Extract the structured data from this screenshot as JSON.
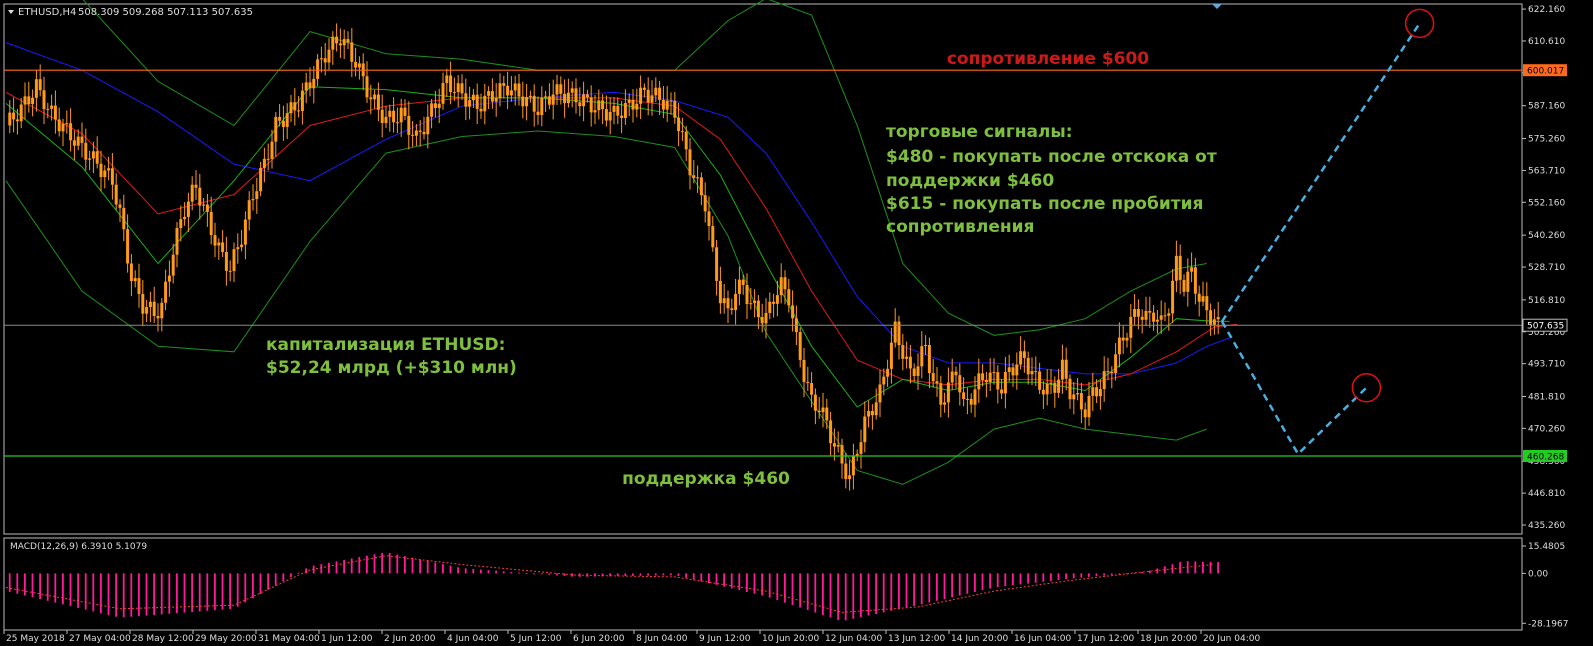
{
  "header": {
    "symbol": "ETHUSD,H4",
    "ohlc": "508.309 509.268 507.113 507.635"
  },
  "annotations": {
    "resistance": "сопротивление $600",
    "support": "поддержка $460",
    "signals_title": "торговые сигналы:",
    "signal_1a": "$480 - покупать после отскока от",
    "signal_1b": "поддержки $460",
    "signal_2a": "$615 - покупать после пробития",
    "signal_2b": "сопротивления",
    "cap_title": "капитализация ETHUSD:",
    "cap_value": "$52,24 млрд (+$310 млн)"
  },
  "macd": {
    "label": "MACD(12,26,9) 6.3910 5.1079",
    "ticks": [
      "15.4805",
      "0.00",
      "-28.1967"
    ]
  },
  "colors": {
    "resistance": "#ff6a1a",
    "support": "#22cc22",
    "current_price": "#8c8c8c",
    "candle": "#ff9a1a",
    "ma_blue": "#1a1aff",
    "ma_red": "#e01a1a",
    "ma_green": "#19b019",
    "bollinger": "#1d8f1d",
    "macd_hist": "#ff1a9c",
    "forecast": "#4aaee0",
    "text_red": "#cc1a1a",
    "text_green": "#7fbf3f"
  },
  "chart_data": {
    "type": "candlestick",
    "symbol": "ETHUSD",
    "timeframe": "H4",
    "y_ticks": [
      "622.160",
      "610.610",
      "599.060",
      "587.160",
      "575.260",
      "563.710",
      "552.160",
      "540.260",
      "528.710",
      "516.810",
      "505.260",
      "493.710",
      "481.810",
      "470.260",
      "458.360",
      "446.810",
      "435.260"
    ],
    "ylim": [
      432,
      624
    ],
    "x_ticks": [
      "25 May 2018",
      "27 May 04:00",
      "28 May 12:00",
      "29 May 20:00",
      "31 May 04:00",
      "1 Jun 12:00",
      "2 Jun 20:00",
      "4 Jun 04:00",
      "5 Jun 12:00",
      "6 Jun 20:00",
      "8 Jun 04:00",
      "9 Jun 12:00",
      "10 Jun 20:00",
      "12 Jun 04:00",
      "13 Jun 12:00",
      "14 Jun 20:00",
      "16 Jun 04:00",
      "17 Jun 12:00",
      "18 Jun 20:00",
      "20 Jun 04:00"
    ],
    "levels": {
      "resistance": 600.017,
      "support": 460.268,
      "current": 507.635
    },
    "price_tags": [
      "600.017",
      "507.635",
      "460.268"
    ],
    "close_path": [
      [
        0,
        580
      ],
      [
        4,
        586
      ],
      [
        8,
        594
      ],
      [
        12,
        584
      ],
      [
        16,
        578
      ],
      [
        20,
        572
      ],
      [
        24,
        566
      ],
      [
        28,
        560
      ],
      [
        30,
        548
      ],
      [
        33,
        525
      ],
      [
        36,
        515
      ],
      [
        39,
        512
      ],
      [
        41,
        514
      ],
      [
        44,
        535
      ],
      [
        47,
        550
      ],
      [
        50,
        558
      ],
      [
        53,
        546
      ],
      [
        56,
        535
      ],
      [
        59,
        528
      ],
      [
        62,
        540
      ],
      [
        65,
        555
      ],
      [
        68,
        566
      ],
      [
        71,
        580
      ],
      [
        74,
        584
      ],
      [
        77,
        588
      ],
      [
        80,
        596
      ],
      [
        84,
        606
      ],
      [
        88,
        612
      ],
      [
        92,
        603
      ],
      [
        96,
        590
      ],
      [
        100,
        582
      ],
      [
        104,
        584
      ],
      [
        108,
        575
      ],
      [
        112,
        585
      ],
      [
        116,
        596
      ],
      [
        120,
        591
      ],
      [
        124,
        587
      ],
      [
        128,
        591
      ],
      [
        132,
        594
      ],
      [
        136,
        590
      ],
      [
        140,
        586
      ],
      [
        144,
        592
      ],
      [
        148,
        591
      ],
      [
        152,
        589
      ],
      [
        156,
        586
      ],
      [
        160,
        584
      ],
      [
        164,
        587
      ],
      [
        168,
        592
      ],
      [
        172,
        590
      ],
      [
        176,
        585
      ],
      [
        178,
        575
      ],
      [
        180,
        565
      ],
      [
        182,
        558
      ],
      [
        184,
        552
      ],
      [
        186,
        533
      ],
      [
        188,
        518
      ],
      [
        190,
        512
      ],
      [
        192,
        520
      ],
      [
        194,
        522
      ],
      [
        196,
        515
      ],
      [
        198,
        512
      ],
      [
        200,
        510
      ],
      [
        202,
        518
      ],
      [
        204,
        522
      ],
      [
        206,
        518
      ],
      [
        208,
        502
      ],
      [
        210,
        490
      ],
      [
        212,
        480
      ],
      [
        214,
        478
      ],
      [
        216,
        472
      ],
      [
        218,
        464
      ],
      [
        220,
        458
      ],
      [
        222,
        452
      ],
      [
        224,
        463
      ],
      [
        226,
        472
      ],
      [
        228,
        478
      ],
      [
        230,
        483
      ],
      [
        232,
        495
      ],
      [
        234,
        506
      ],
      [
        236,
        498
      ],
      [
        238,
        490
      ],
      [
        240,
        494
      ],
      [
        242,
        500
      ],
      [
        244,
        487
      ],
      [
        246,
        480
      ],
      [
        248,
        485
      ],
      [
        250,
        492
      ],
      [
        252,
        478
      ],
      [
        254,
        482
      ],
      [
        256,
        487
      ],
      [
        258,
        490
      ],
      [
        260,
        488
      ],
      [
        262,
        485
      ],
      [
        264,
        491
      ],
      [
        266,
        494
      ],
      [
        268,
        496
      ],
      [
        270,
        490
      ],
      [
        272,
        486
      ],
      [
        274,
        484
      ],
      [
        276,
        486
      ],
      [
        278,
        492
      ],
      [
        280,
        484
      ],
      [
        282,
        480
      ],
      [
        284,
        477
      ],
      [
        286,
        483
      ],
      [
        288,
        486
      ],
      [
        290,
        490
      ],
      [
        292,
        497
      ],
      [
        294,
        503
      ],
      [
        296,
        509
      ],
      [
        298,
        513
      ],
      [
        300,
        510
      ],
      [
        302,
        512
      ],
      [
        304,
        508
      ],
      [
        306,
        515
      ],
      [
        308,
        530
      ],
      [
        310,
        522
      ],
      [
        312,
        527
      ],
      [
        314,
        517
      ],
      [
        316,
        513
      ],
      [
        318,
        509
      ],
      [
        319,
        507.6
      ]
    ],
    "series": [
      {
        "name": "MA blue",
        "values": [
          [
            0,
            610
          ],
          [
            20,
            600
          ],
          [
            40,
            585
          ],
          [
            60,
            566
          ],
          [
            80,
            560
          ],
          [
            100,
            575
          ],
          [
            120,
            587
          ],
          [
            140,
            590
          ],
          [
            160,
            592
          ],
          [
            176,
            589
          ],
          [
            190,
            583
          ],
          [
            200,
            570
          ],
          [
            212,
            545
          ],
          [
            224,
            518
          ],
          [
            236,
            500
          ],
          [
            248,
            494
          ],
          [
            260,
            494
          ],
          [
            272,
            492
          ],
          [
            284,
            490
          ],
          [
            296,
            490
          ],
          [
            308,
            494
          ],
          [
            316,
            500
          ],
          [
            322,
            503
          ]
        ]
      },
      {
        "name": "MA red",
        "values": [
          [
            0,
            592
          ],
          [
            20,
            577
          ],
          [
            40,
            548
          ],
          [
            60,
            555
          ],
          [
            80,
            580
          ],
          [
            100,
            587
          ],
          [
            120,
            590
          ],
          [
            140,
            590
          ],
          [
            160,
            590
          ],
          [
            176,
            587
          ],
          [
            188,
            575
          ],
          [
            200,
            550
          ],
          [
            212,
            520
          ],
          [
            224,
            495
          ],
          [
            236,
            488
          ],
          [
            248,
            486
          ],
          [
            260,
            488
          ],
          [
            272,
            488
          ],
          [
            284,
            486
          ],
          [
            296,
            490
          ],
          [
            308,
            498
          ],
          [
            318,
            507
          ],
          [
            324,
            508
          ]
        ]
      },
      {
        "name": "MA green",
        "values": [
          [
            0,
            588
          ],
          [
            20,
            565
          ],
          [
            40,
            530
          ],
          [
            60,
            560
          ],
          [
            80,
            594
          ],
          [
            100,
            593
          ],
          [
            120,
            590
          ],
          [
            140,
            590
          ],
          [
            160,
            588
          ],
          [
            176,
            584
          ],
          [
            188,
            562
          ],
          [
            200,
            530
          ],
          [
            212,
            500
          ],
          [
            224,
            478
          ],
          [
            236,
            488
          ],
          [
            248,
            484
          ],
          [
            260,
            487
          ],
          [
            272,
            487
          ],
          [
            284,
            484
          ],
          [
            296,
            496
          ],
          [
            308,
            510
          ],
          [
            318,
            509
          ],
          [
            322,
            509
          ]
        ]
      },
      {
        "name": "BB upper",
        "values": [
          [
            0,
            640
          ],
          [
            20,
            630
          ],
          [
            40,
            596
          ],
          [
            60,
            580
          ],
          [
            80,
            614
          ],
          [
            100,
            606
          ],
          [
            120,
            604
          ],
          [
            140,
            600
          ],
          [
            160,
            600
          ],
          [
            176,
            600
          ],
          [
            190,
            618
          ],
          [
            200,
            640
          ],
          [
            212,
            620
          ],
          [
            224,
            580
          ],
          [
            236,
            530
          ],
          [
            248,
            512
          ],
          [
            260,
            504
          ],
          [
            272,
            506
          ],
          [
            284,
            510
          ],
          [
            296,
            520
          ],
          [
            308,
            528
          ],
          [
            316,
            530
          ]
        ]
      },
      {
        "name": "BB lower",
        "values": [
          [
            0,
            560
          ],
          [
            20,
            520
          ],
          [
            40,
            500
          ],
          [
            60,
            498
          ],
          [
            80,
            538
          ],
          [
            100,
            570
          ],
          [
            120,
            576
          ],
          [
            140,
            578
          ],
          [
            160,
            576
          ],
          [
            176,
            572
          ],
          [
            190,
            540
          ],
          [
            200,
            505
          ],
          [
            212,
            480
          ],
          [
            224,
            455
          ],
          [
            236,
            450
          ],
          [
            248,
            458
          ],
          [
            260,
            470
          ],
          [
            272,
            474
          ],
          [
            284,
            470
          ],
          [
            296,
            468
          ],
          [
            308,
            466
          ],
          [
            316,
            470
          ]
        ]
      }
    ],
    "forecast": [
      [
        320,
        509
      ],
      [
        340,
        461
      ],
      [
        358,
        485
      ]
    ],
    "forecast_up": [
      [
        320,
        509
      ],
      [
        372,
        617
      ]
    ],
    "targets": [
      [
        358,
        485
      ],
      [
        372,
        617
      ]
    ],
    "macd_hist_path": [
      [
        0,
        -10
      ],
      [
        30,
        -25
      ],
      [
        60,
        -20
      ],
      [
        80,
        4
      ],
      [
        100,
        12
      ],
      [
        120,
        3
      ],
      [
        150,
        -2
      ],
      [
        176,
        -1
      ],
      [
        200,
        -13
      ],
      [
        220,
        -27
      ],
      [
        240,
        -18
      ],
      [
        260,
        -8
      ],
      [
        280,
        -3
      ],
      [
        300,
        1
      ],
      [
        310,
        7
      ],
      [
        318,
        6.4
      ]
    ],
    "macd_signal_path": [
      [
        0,
        -8
      ],
      [
        30,
        -20
      ],
      [
        60,
        -18
      ],
      [
        80,
        2
      ],
      [
        100,
        10
      ],
      [
        120,
        5
      ],
      [
        150,
        -1
      ],
      [
        176,
        -2
      ],
      [
        200,
        -10
      ],
      [
        220,
        -22
      ],
      [
        240,
        -19
      ],
      [
        260,
        -10
      ],
      [
        280,
        -4
      ],
      [
        300,
        1
      ],
      [
        318,
        5.1
      ]
    ]
  }
}
